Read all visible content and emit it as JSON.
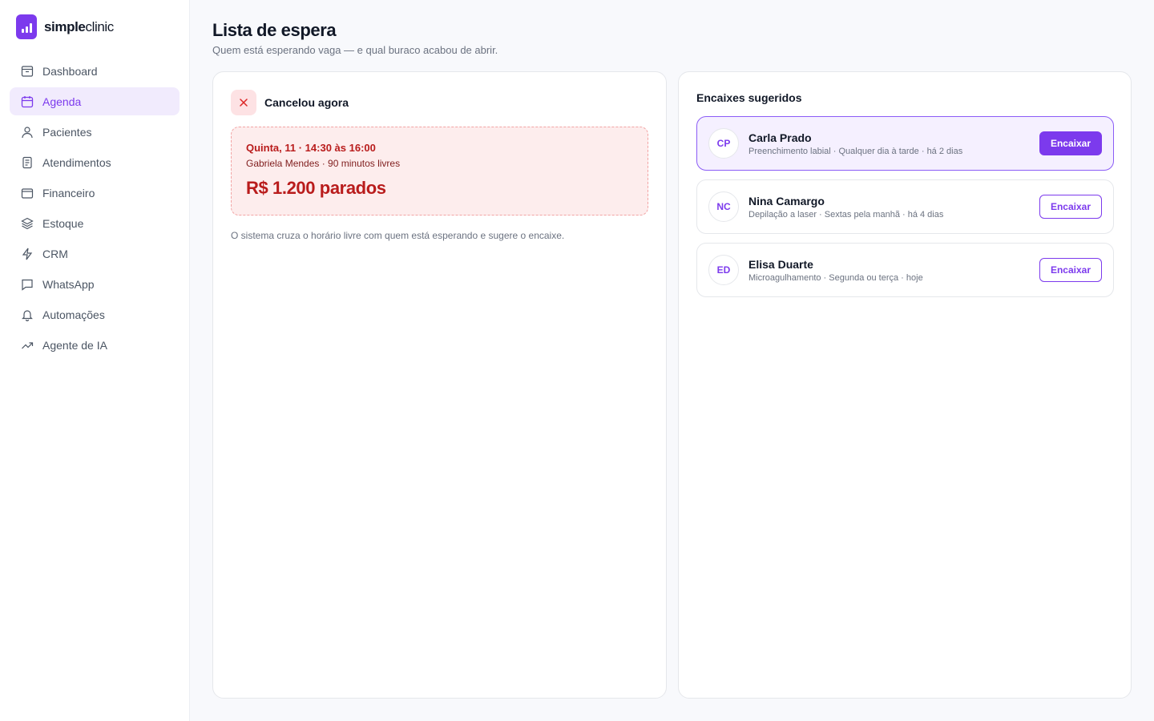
{
  "brand": {
    "bold": "simple",
    "light": "clinic"
  },
  "nav": [
    {
      "label": "Dashboard",
      "icon": "dashboard-icon",
      "active": false
    },
    {
      "label": "Agenda",
      "icon": "calendar-icon",
      "active": true
    },
    {
      "label": "Pacientes",
      "icon": "user-icon",
      "active": false
    },
    {
      "label": "Atendimentos",
      "icon": "clipboard-icon",
      "active": false
    },
    {
      "label": "Financeiro",
      "icon": "wallet-icon",
      "active": false
    },
    {
      "label": "Estoque",
      "icon": "layers-icon",
      "active": false
    },
    {
      "label": "CRM",
      "icon": "bolt-icon",
      "active": false
    },
    {
      "label": "WhatsApp",
      "icon": "chat-icon",
      "active": false
    },
    {
      "label": "Automações",
      "icon": "bell-icon",
      "active": false
    },
    {
      "label": "Agente de IA",
      "icon": "trend-icon",
      "active": false
    }
  ],
  "page": {
    "title": "Lista de espera",
    "subtitle": "Quem está esperando vaga — e qual buraco acabou de abrir."
  },
  "cancel": {
    "title": "Cancelou agora",
    "when": "Quinta, 11 · 14:30 às 16:00",
    "who": "Gabriela Mendes · 90 minutos livres",
    "value": "R$ 1.200 parados",
    "hint": "O sistema cruza o horário livre com quem está esperando e sugere o encaixe."
  },
  "suggestions": {
    "title": "Encaixes sugeridos",
    "button_label": "Encaixar",
    "items": [
      {
        "initials": "CP",
        "name": "Carla Prado",
        "meta": "Preenchimento labial · Qualquer dia à tarde · há 2 dias",
        "featured": true
      },
      {
        "initials": "NC",
        "name": "Nina Camargo",
        "meta": "Depilação a laser · Sextas pela manhã · há 4 dias",
        "featured": false
      },
      {
        "initials": "ED",
        "name": "Elisa Duarte",
        "meta": "Microagulhamento · Segunda ou terça · hoje",
        "featured": false
      }
    ]
  },
  "colors": {
    "accent": "#7c3aed",
    "danger": "#b91c1c",
    "danger_bg": "#fdeded"
  }
}
